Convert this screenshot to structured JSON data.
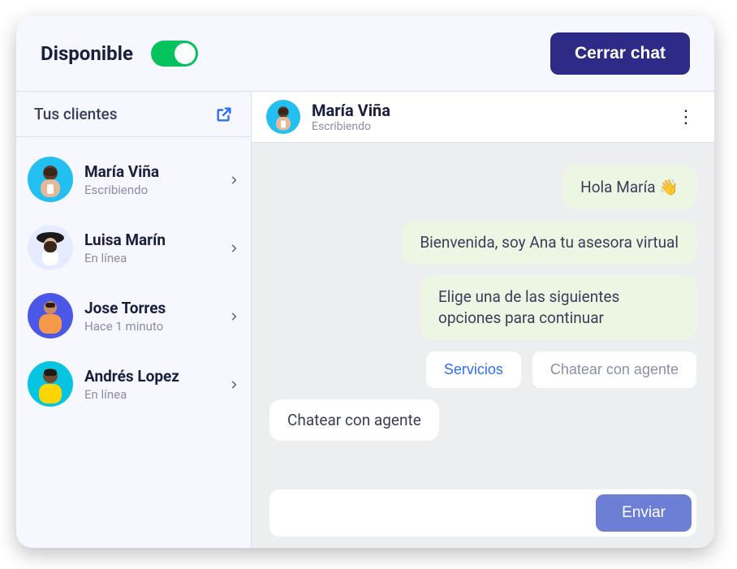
{
  "header": {
    "status_label": "Disponible",
    "toggle_on": true,
    "close_chat_label": "Cerrar chat"
  },
  "sidebar": {
    "title": "Tus clientes",
    "popout_icon": "external-link-icon",
    "clients": [
      {
        "name": "María Viña",
        "status": "Escribiendo",
        "avatar_bg": "#22c0f0"
      },
      {
        "name": "Luisa Marín",
        "status": "En línea",
        "avatar_bg": "#d9defb"
      },
      {
        "name": "Jose Torres",
        "status": "Hace 1 minuto",
        "avatar_bg": "#4b57e6"
      },
      {
        "name": "Andrés Lopez",
        "status": "En línea",
        "avatar_bg": "#ffd500"
      }
    ]
  },
  "chat": {
    "active_client": {
      "name": "María Viña",
      "status": "Escribiendo",
      "avatar_bg": "#22c0f0"
    },
    "messages": [
      {
        "kind": "agent",
        "text": "Hola María 👋"
      },
      {
        "kind": "agent",
        "text": "Bienvenida, soy Ana tu asesora virtual"
      },
      {
        "kind": "agent",
        "text": "Elige una de las siguientes opciones para continuar"
      },
      {
        "kind": "options",
        "buttons": [
          {
            "label": "Servicios",
            "primary": true
          },
          {
            "label": "Chatear con agente",
            "primary": false
          }
        ]
      },
      {
        "kind": "user",
        "text": "Chatear con agente"
      }
    ],
    "input_placeholder": "",
    "send_label": "Enviar"
  },
  "colors": {
    "accent_green": "#04c35c",
    "brand_dark": "#2e2b87",
    "link_blue": "#2f6df6",
    "bubble_green": "#ecf6e3",
    "send_btn": "#6d7fd4"
  }
}
